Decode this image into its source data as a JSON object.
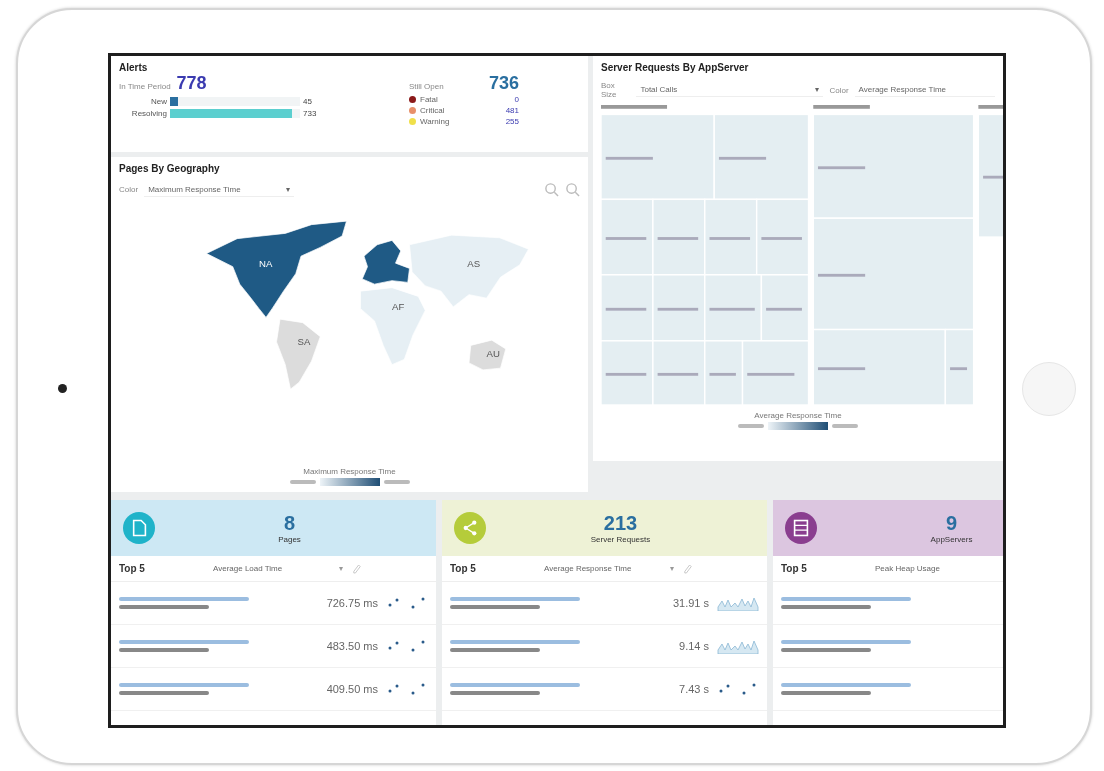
{
  "alerts": {
    "title": "Alerts",
    "period_label": "In Time Period",
    "period_count": "778",
    "open_label": "Still Open",
    "open_count": "736",
    "bars": [
      {
        "label": "New",
        "value": "45",
        "level": 0.06,
        "color": "#2a6fa0"
      },
      {
        "label": "Resolving",
        "value": "733",
        "level": 0.94,
        "color": "#5bcfcf"
      }
    ],
    "severities": [
      {
        "label": "Fatal",
        "count": "0",
        "color": "#8b1a1a"
      },
      {
        "label": "Critical",
        "count": "481",
        "color": "#e8906a"
      },
      {
        "label": "Warning",
        "count": "255",
        "color": "#f0e04a"
      }
    ]
  },
  "geography": {
    "title": "Pages By Geography",
    "color_label": "Color",
    "metric": "Maximum Response Time",
    "caret": "▾",
    "legend_title": "Maximum Response Time",
    "regions": [
      {
        "kind": "north-america",
        "label": "NA",
        "color": "#1f5a85"
      },
      {
        "kind": "europe",
        "color": "#1f5a85"
      },
      {
        "kind": "asia",
        "label": "AS",
        "color": "#e6eff4"
      },
      {
        "kind": "africa",
        "label": "AF",
        "color": "#e6eff4"
      },
      {
        "kind": "south-america",
        "label": "SA",
        "color": "#dcdcdc"
      },
      {
        "kind": "australia",
        "label": "AU",
        "color": "#dcdcdc"
      }
    ]
  },
  "server_requests": {
    "title": "Server Requests By AppServer",
    "box_size_label": "Box Size",
    "box_size": "Total Calls",
    "caret": "▾",
    "color_label": "Color",
    "color_metric": "Average Response Time",
    "legend_title": "Average Response Time"
  },
  "tiles": [
    {
      "kind": "pages",
      "count": "8",
      "label": "Pages",
      "color": "#cde8f4",
      "top_label": "Top 5",
      "metric": "Average Load Time",
      "caret": "▾",
      "rows": [
        {
          "value": "726.75 ms",
          "kind": "dots"
        },
        {
          "value": "483.50 ms",
          "kind": "dots"
        },
        {
          "value": "409.50 ms",
          "kind": "dots"
        }
      ]
    },
    {
      "kind": "requests",
      "count": "213",
      "label": "Server Requests",
      "color": "#eef2d6",
      "top_label": "Top 5",
      "metric": "Average Response Time",
      "caret": "▾",
      "rows": [
        {
          "value": "31.91 s",
          "kind": "area"
        },
        {
          "value": "9.14 s",
          "kind": "area"
        },
        {
          "value": "7.43 s",
          "kind": "dots"
        }
      ]
    },
    {
      "kind": "servers",
      "count": "9",
      "label": "AppServers",
      "color": "#dcc6e0",
      "top_label": "Top 5",
      "metric": "Peak Heap Usage",
      "rows": [
        {},
        {},
        {}
      ]
    }
  ]
}
